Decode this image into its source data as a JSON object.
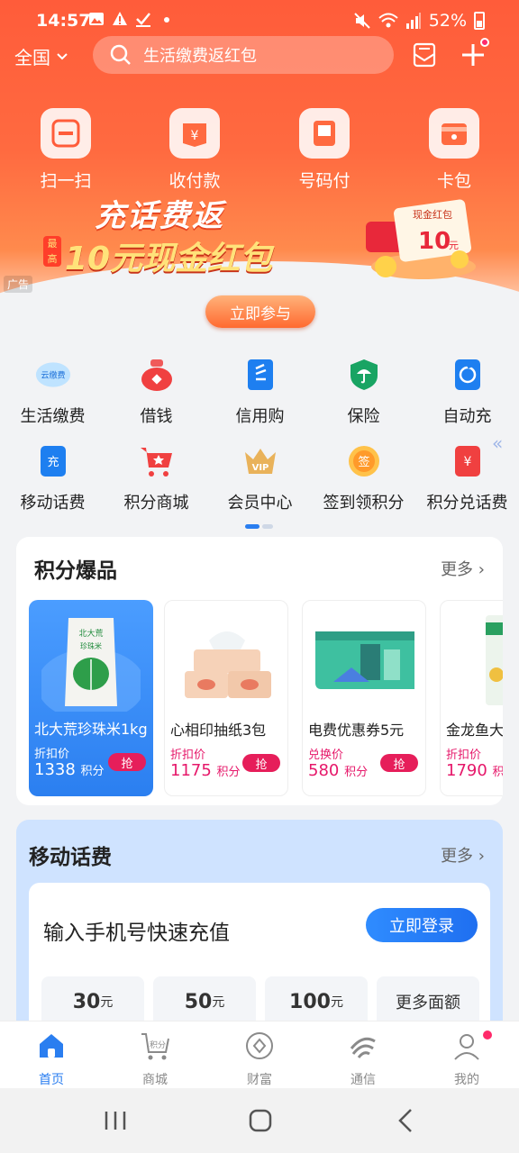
{
  "status_bar": {
    "time": "14:57",
    "battery": "52%"
  },
  "top": {
    "region": "全国",
    "search_placeholder": "生活缴费返红包"
  },
  "quick_actions": [
    {
      "label": "扫一扫",
      "icon": "scan-icon"
    },
    {
      "label": "收付款",
      "icon": "payment-icon"
    },
    {
      "label": "号码付",
      "icon": "number-pay-icon"
    },
    {
      "label": "卡包",
      "icon": "card-wallet-icon"
    }
  ],
  "banner": {
    "title": "充话费返",
    "highlight": "最高",
    "subtitle": "10元现金红包",
    "redpack_label": "现金红包",
    "redpack_amount": "10",
    "redpack_unit": "元",
    "ad_tag": "广告",
    "cta": "立即参与"
  },
  "services": [
    {
      "label": "生活缴费",
      "icon": "utility-pay-icon",
      "icon_text": "云缴费"
    },
    {
      "label": "借钱",
      "icon": "loan-bag-icon"
    },
    {
      "label": "信用购",
      "icon": "credit-book-icon"
    },
    {
      "label": "保险",
      "icon": "insurance-umbrella-icon"
    },
    {
      "label": "自动充",
      "icon": "auto-recharge-icon"
    },
    {
      "label": "移动话费",
      "icon": "mobile-topup-icon",
      "icon_text": "充"
    },
    {
      "label": "积分商城",
      "icon": "points-mall-cart-icon"
    },
    {
      "label": "会员中心",
      "icon": "vip-crown-icon",
      "icon_text": "VIP"
    },
    {
      "label": "签到领积分",
      "icon": "check-in-icon",
      "icon_text": "签"
    },
    {
      "label": "积分兑话费",
      "icon": "points-exchange-icon",
      "icon_text": "¥"
    }
  ],
  "points_section": {
    "title": "积分爆品",
    "more": "更多",
    "products": [
      {
        "name": "北大荒珍珠米1kg",
        "price_type": "折扣价",
        "price": "1338",
        "unit": "积分",
        "button": "抢",
        "image": "rice-bag-image",
        "pack_brand": "北大荒",
        "pack_title": "珍珠米"
      },
      {
        "name": "心相印抽纸3包",
        "price_type": "折扣价",
        "price": "1175",
        "unit": "积分",
        "button": "抢",
        "image": "tissue-pack-image"
      },
      {
        "name": "电费优惠券5元",
        "price_type": "兑换价",
        "price": "580",
        "unit": "积分",
        "button": "抢",
        "image": "electric-coupon-image"
      },
      {
        "name": "金龙鱼大",
        "price_type": "折扣价",
        "price": "1790",
        "unit": "积分",
        "image": "jinlongyu-image"
      }
    ]
  },
  "mobile_section": {
    "title": "移动话费",
    "more": "更多",
    "prompt": "输入手机号快速充值",
    "login": "立即登录",
    "amounts": [
      {
        "value": "30",
        "unit": "元"
      },
      {
        "value": "50",
        "unit": "元"
      },
      {
        "value": "100",
        "unit": "元"
      },
      {
        "value": "更多面额",
        "unit": ""
      }
    ]
  },
  "tabs": [
    {
      "label": "首页",
      "icon": "home-icon",
      "active": true
    },
    {
      "label": "商城",
      "icon": "mall-cart-icon",
      "icon_text": "积分",
      "active": false
    },
    {
      "label": "财富",
      "icon": "wealth-coin-icon",
      "active": false
    },
    {
      "label": "通信",
      "icon": "china-mobile-icon",
      "active": false
    },
    {
      "label": "我的",
      "icon": "profile-icon",
      "active": false
    }
  ],
  "colors": {
    "hero": "#ff5c3a",
    "accent_blue": "#2a7ef0",
    "points_pink": "#e6186a"
  }
}
